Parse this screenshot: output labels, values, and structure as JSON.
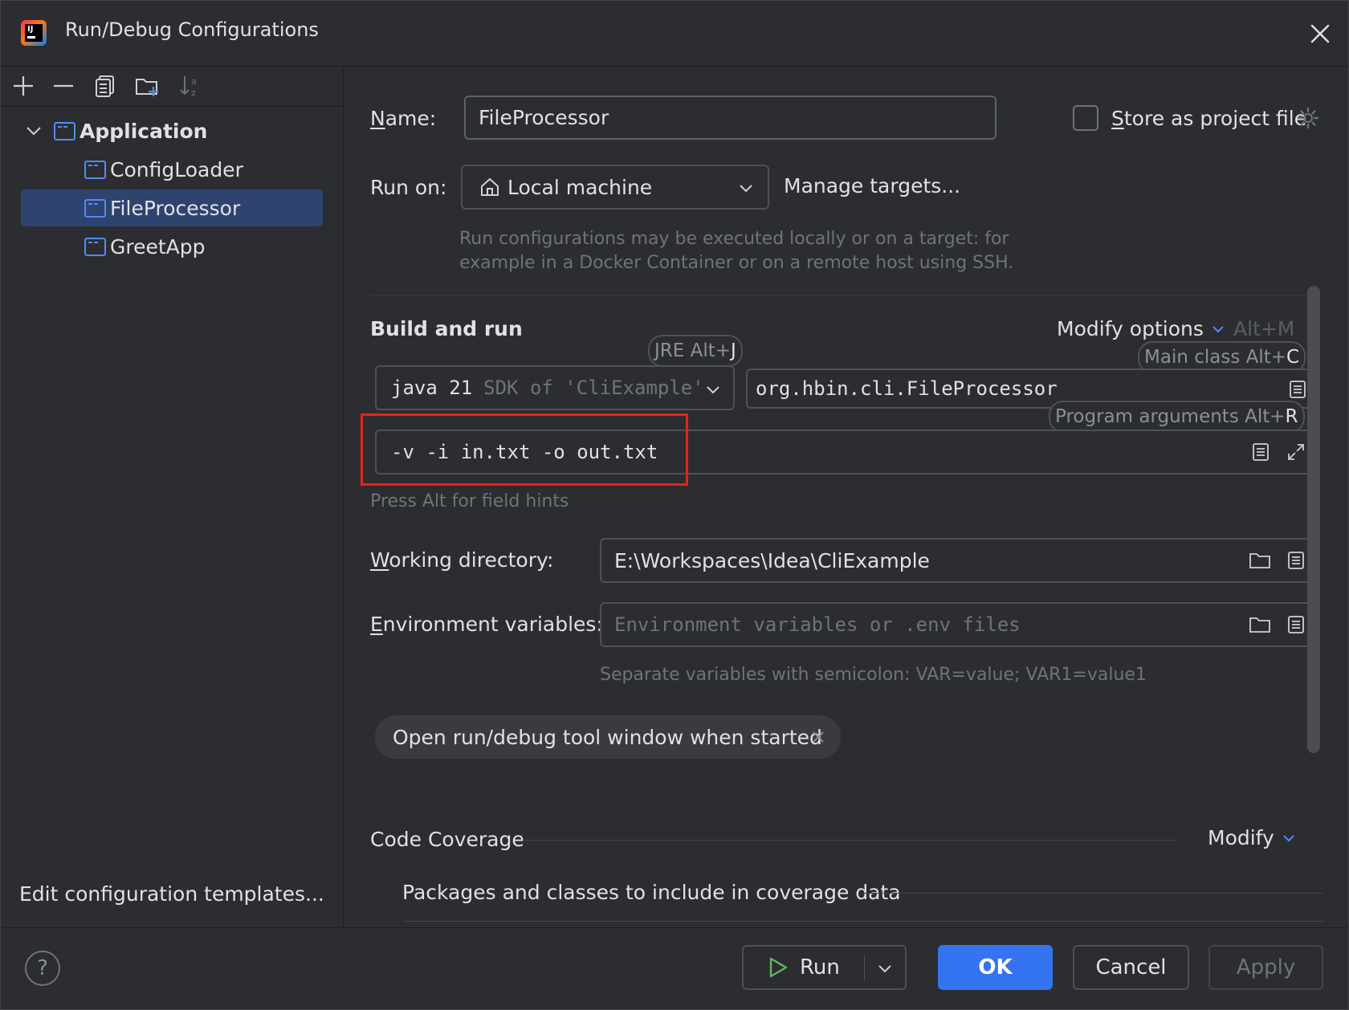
{
  "window": {
    "title": "Run/Debug Configurations"
  },
  "sidebar": {
    "toolbar_icons": [
      "add-icon",
      "remove-icon",
      "copy-icon",
      "new-folder-icon",
      "sort-icon"
    ],
    "group": {
      "label": "Application",
      "expanded": true
    },
    "items": [
      {
        "label": "ConfigLoader",
        "selected": false
      },
      {
        "label": "FileProcessor",
        "selected": true
      },
      {
        "label": "GreetApp",
        "selected": false
      }
    ],
    "edit_templates_link": "Edit configuration templates..."
  },
  "form": {
    "name_label": "Name:",
    "name_value": "FileProcessor",
    "store_label": "Store as project file",
    "store_checked": false,
    "run_on_label": "Run on:",
    "run_on_value": "Local machine",
    "manage_targets": "Manage targets...",
    "run_on_hint_1": "Run configurations may be executed locally or on a target: for",
    "run_on_hint_2": "example in a Docker Container or on a remote host using SSH.",
    "build_run_title": "Build and run",
    "modify_options": "Modify options",
    "modify_options_shortcut": "Alt+M",
    "jre_chip": "JRE Alt+",
    "jre_chip_key": "J",
    "main_class_chip": "Main class Alt+",
    "main_class_chip_key": "C",
    "program_args_chip": "Program arguments Alt+",
    "program_args_chip_key": "R",
    "sdk_version": "java 21",
    "sdk_desc": "SDK of 'CliExample'",
    "main_class_value": "org.hbin.cli.FileProcessor",
    "program_args_value": "-v -i in.txt -o out.txt",
    "field_hints": "Press Alt for field hints",
    "working_dir_label": "Working directory:",
    "working_dir_value": "E:\\Workspaces\\Idea\\CliExample",
    "env_label": "Environment variables:",
    "env_placeholder": "Environment variables or .env files",
    "env_hint": "Separate variables with semicolon: VAR=value; VAR1=value1",
    "tag_label": "Open run/debug tool window when started",
    "coverage_title": "Code Coverage",
    "coverage_modify": "Modify",
    "coverage_packages": "Packages and classes to include in coverage data"
  },
  "footer": {
    "help": "?",
    "run": "Run",
    "ok": "OK",
    "cancel": "Cancel",
    "apply": "Apply"
  },
  "colors": {
    "accent": "#3574f0",
    "link": "#548af7",
    "highlight_box": "#e3251d",
    "selection": "#2e436e"
  }
}
